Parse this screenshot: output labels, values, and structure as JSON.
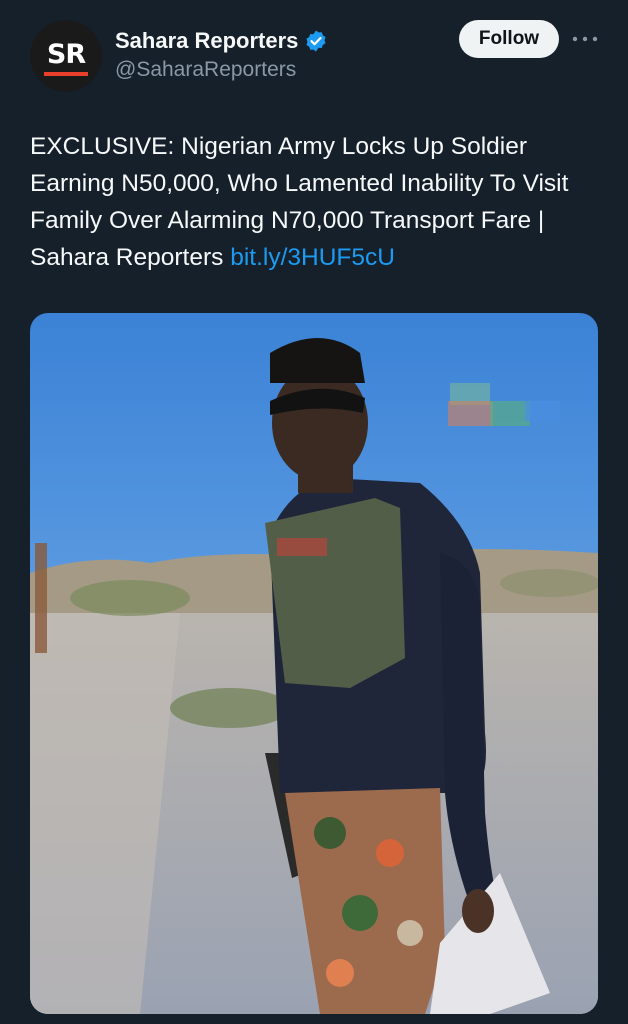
{
  "account": {
    "avatar_text": "SR",
    "display_name": "Sahara Reporters",
    "handle": "@SaharaReporters",
    "verified_icon": "verified-badge-icon"
  },
  "actions": {
    "follow_label": "Follow",
    "more_icon": "more-options-icon"
  },
  "tweet": {
    "text": "EXCLUSIVE: Nigerian Army Locks Up Soldier Earning N50,000, Who Lamented Inability To Visit Family Over Alarming N70,000 Transport Fare | Sahara Reporters ",
    "link": "bit.ly/3HUF5cU"
  },
  "colors": {
    "background": "#15202b",
    "link": "#1d9bf0",
    "verified": "#1d9bf0",
    "follow_button": "#eff3f4",
    "avatar_accent": "#e8402a"
  }
}
